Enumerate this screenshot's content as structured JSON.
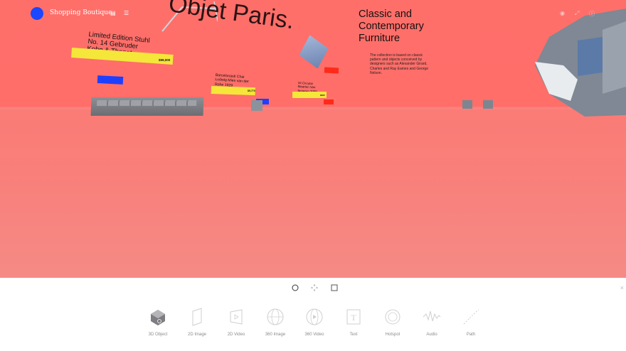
{
  "header": {
    "brand": "Shopping Boutique",
    "icons": [
      "grid-icon",
      "menu-icon",
      "camera-icon",
      "expand-icon",
      "help-icon"
    ]
  },
  "scene": {
    "big_title": "Objet Paris.",
    "headline": "Classic and Contemporary Furniture",
    "description": "The collection is based on classic pattern and objects conceived by designers such as Alexander Girard, Charles and Ray Eames and George Nelson.",
    "products": [
      {
        "label": "Limited Edition Stuhl No. 14 Gebruder Kohn & Thonet",
        "price": "$99,000"
      },
      {
        "label": "Barcelonasti Chai Ludwig Mies van der Rohe 1929",
        "price": "$5,770"
      },
      {
        "label": "34 Circular Maarten Van Severen 2008",
        "price": "$960"
      }
    ]
  },
  "toolbar": {
    "modes": [
      "circle-mode-icon",
      "move-mode-icon",
      "square-mode-icon"
    ],
    "tools": [
      {
        "label": "3D Object",
        "icon": "3d-object-icon"
      },
      {
        "label": "2D Image",
        "icon": "2d-image-icon"
      },
      {
        "label": "2D Video",
        "icon": "2d-video-icon"
      },
      {
        "label": "360 Image",
        "icon": "360-image-icon"
      },
      {
        "label": "360 Video",
        "icon": "360-video-icon"
      },
      {
        "label": "Text",
        "icon": "text-icon"
      },
      {
        "label": "Hotspot",
        "icon": "hotspot-icon"
      },
      {
        "label": "Audio",
        "icon": "audio-icon"
      },
      {
        "label": "Path",
        "icon": "path-icon"
      }
    ],
    "close": "×"
  },
  "colors": {
    "scene_bg": "#ff6f6a",
    "accent_blue": "#1a47ff",
    "price_yellow": "#f5e63a",
    "button_red": "#ff2a1a"
  }
}
